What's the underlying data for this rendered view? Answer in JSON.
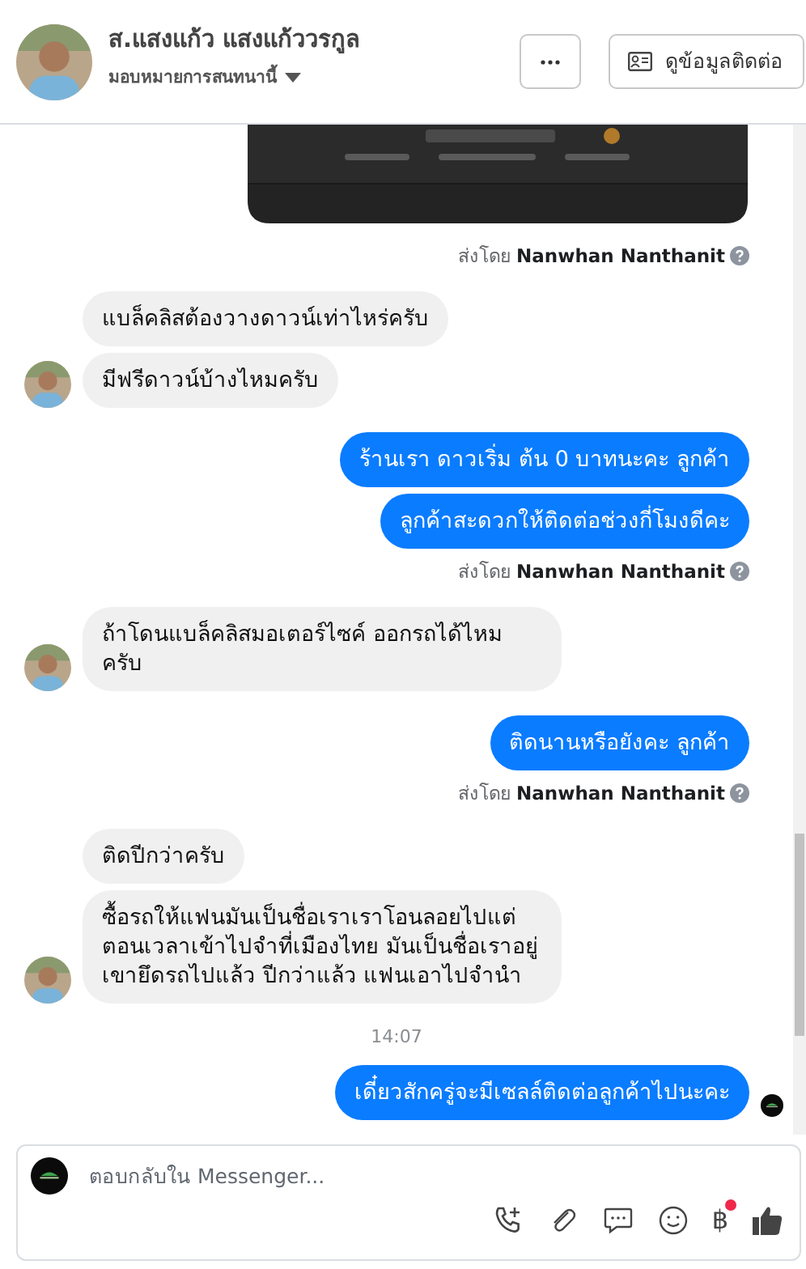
{
  "header": {
    "name": "ส.แสงแก้ว แสงแก้ววรกูล",
    "subtitle": "มอบหมายการสนทนานี้",
    "contact_button": "ดูข้อมูลติดต่อ"
  },
  "thread": [
    {
      "kind": "picture"
    },
    {
      "kind": "note",
      "prefix": "ส่งโดย",
      "sender": "Nanwhan Nanthanit"
    },
    {
      "kind": "received",
      "text": "แบล็คลิสต้องวางดาวน์เท่าไหร่ครับ",
      "avatar": false
    },
    {
      "kind": "received",
      "text": "มีฟรีดาวน์บ้างไหมครับ",
      "avatar": true
    },
    {
      "kind": "sent",
      "text": "ร้านเรา ดาวเริ่ม ต้น 0 บาทนะคะ ลูกค้า",
      "seen": false
    },
    {
      "kind": "sent",
      "text": "ลูกค้าสะดวกให้ติดต่อช่วงกี่โมงดีคะ",
      "seen": false
    },
    {
      "kind": "note",
      "prefix": "ส่งโดย",
      "sender": "Nanwhan Nanthanit"
    },
    {
      "kind": "received",
      "text": "ถ้าโดนแบล็คลิสมอเตอร์ไซค์ ออกรถได้ไหมครับ",
      "avatar": true
    },
    {
      "kind": "sent",
      "text": "ติดนานหรือยังคะ ลูกค้า",
      "seen": false
    },
    {
      "kind": "note",
      "prefix": "ส่งโดย",
      "sender": "Nanwhan Nanthanit"
    },
    {
      "kind": "received",
      "text": "ติดปีกว่าครับ",
      "avatar": false
    },
    {
      "kind": "received",
      "text": "ซื้อรถให้แฟนมันเป็นชื่อเราเราโอนลอยไปแต่ตอนเวลาเข้าไปจำที่เมืองไทย มันเป็นชื่อเราอยู่ เขายึดรถไปแล้ว ปีกว่าแล้ว แฟนเอาไปจำนำ",
      "avatar": true
    },
    {
      "kind": "time",
      "text": "14:07"
    },
    {
      "kind": "sent",
      "text": "เดี๋ยวสักครู่จะมีเซลล์ติดต่อลูกค้าไปนะคะ",
      "seen": true
    }
  ],
  "composer": {
    "placeholder": "ตอบกลับใน Messenger...",
    "tools": [
      {
        "kind": "call",
        "notification_dot": false
      },
      {
        "kind": "attach",
        "notification_dot": false
      },
      {
        "kind": "chat",
        "notification_dot": false
      },
      {
        "kind": "emoji",
        "notification_dot": false
      },
      {
        "kind": "payment",
        "glyph": "฿",
        "notification_dot": true
      },
      {
        "kind": "like",
        "notification_dot": false
      }
    ]
  }
}
